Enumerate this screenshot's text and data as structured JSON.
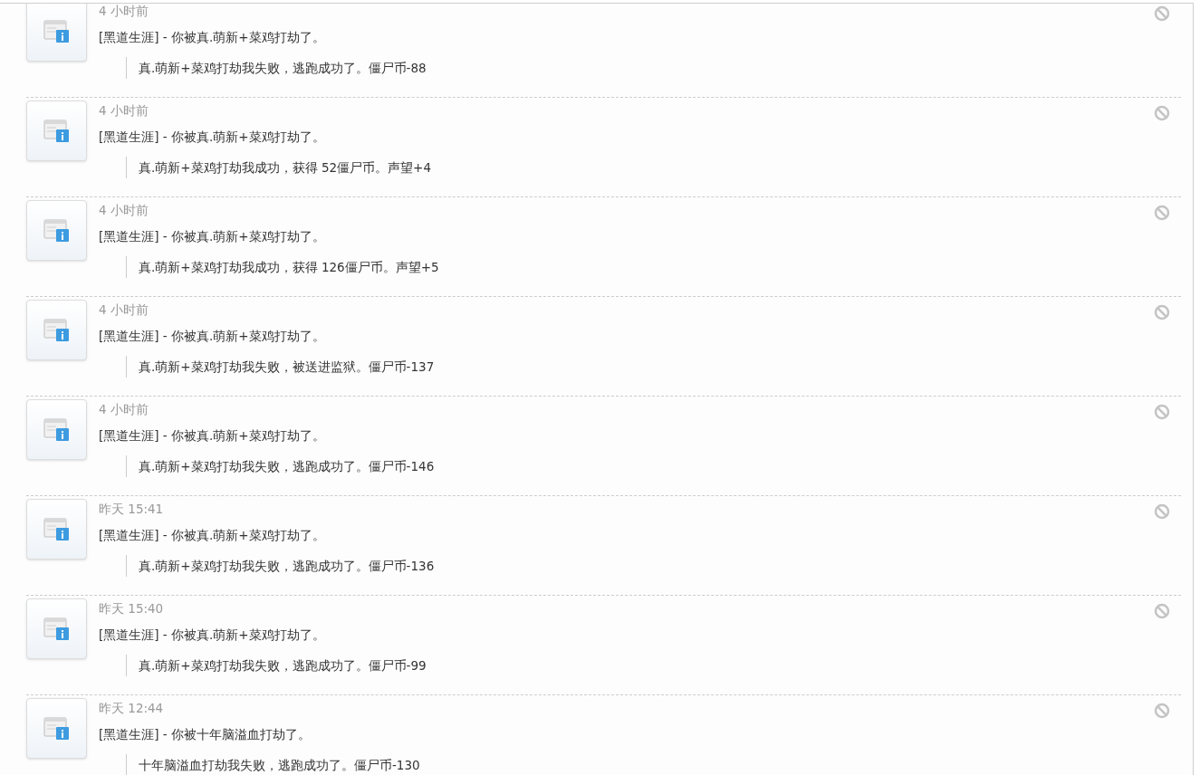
{
  "notices": [
    {
      "time": "4 小时前",
      "title": "[黑道生涯] - 你被真.萌新+菜鸡打劫了。",
      "detail": "真.萌新+菜鸡打劫我失败，逃跑成功了。僵尸币-88"
    },
    {
      "time": "4 小时前",
      "title": "[黑道生涯] - 你被真.萌新+菜鸡打劫了。",
      "detail": "真.萌新+菜鸡打劫我成功，获得 52僵尸币。声望+4"
    },
    {
      "time": "4 小时前",
      "title": "[黑道生涯] - 你被真.萌新+菜鸡打劫了。",
      "detail": "真.萌新+菜鸡打劫我成功，获得 126僵尸币。声望+5"
    },
    {
      "time": "4 小时前",
      "title": "[黑道生涯] - 你被真.萌新+菜鸡打劫了。",
      "detail": "真.萌新+菜鸡打劫我失败，被送进监狱。僵尸币-137"
    },
    {
      "time": "4 小时前",
      "title": "[黑道生涯] - 你被真.萌新+菜鸡打劫了。",
      "detail": "真.萌新+菜鸡打劫我失败，逃跑成功了。僵尸币-146"
    },
    {
      "time": "昨天 15:41",
      "title": "[黑道生涯] - 你被真.萌新+菜鸡打劫了。",
      "detail": "真.萌新+菜鸡打劫我失败，逃跑成功了。僵尸币-136"
    },
    {
      "time": "昨天 15:40",
      "title": "[黑道生涯] - 你被真.萌新+菜鸡打劫了。",
      "detail": "真.萌新+菜鸡打劫我失败，逃跑成功了。僵尸币-99"
    },
    {
      "time": "昨天 12:44",
      "title": "[黑道生涯] - 你被十年脑溢血打劫了。",
      "detail": "十年脑溢血打劫我失败，逃跑成功了。僵尸币-130"
    }
  ]
}
